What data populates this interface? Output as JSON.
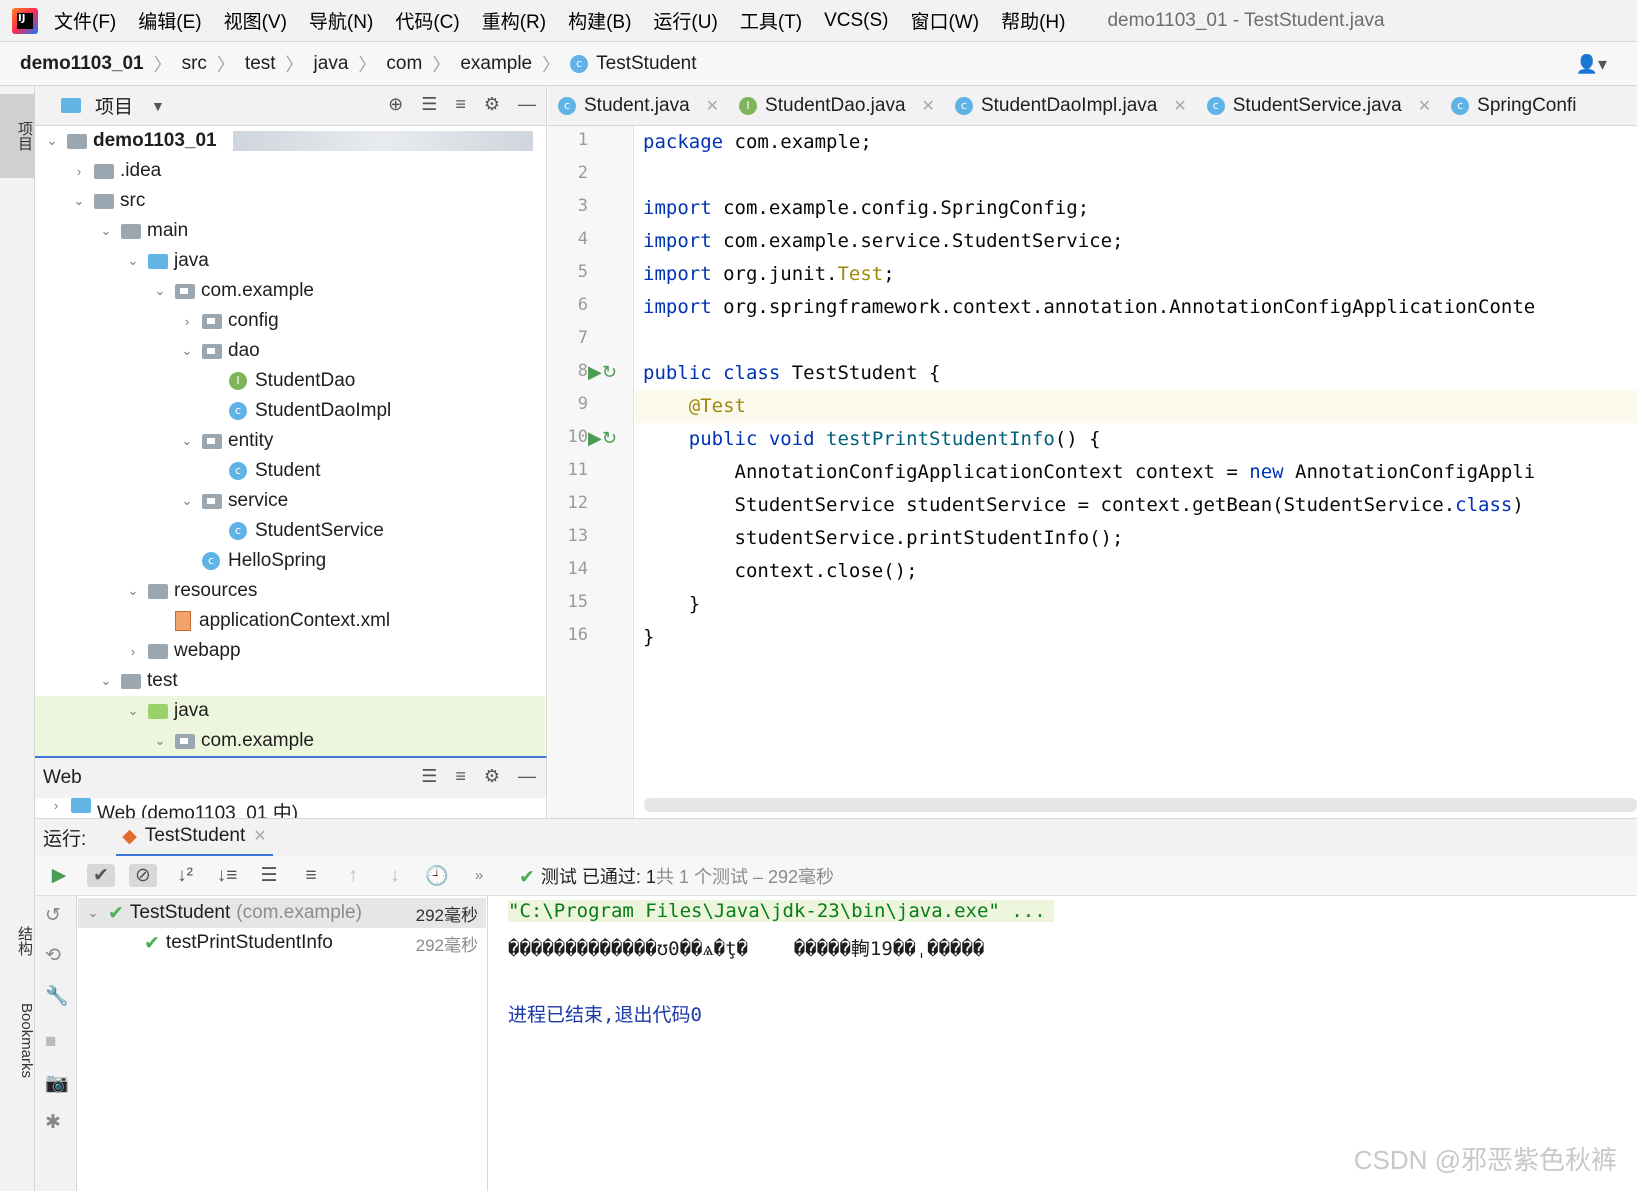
{
  "menu": {
    "items": [
      "文件(F)",
      "编辑(E)",
      "视图(V)",
      "导航(N)",
      "代码(C)",
      "重构(R)",
      "构建(B)",
      "运行(U)",
      "工具(T)",
      "VCS(S)",
      "窗口(W)",
      "帮助(H)"
    ],
    "window_title": "demo1103_01 - TestStudent.java"
  },
  "breadcrumb": [
    "demo1103_01",
    "src",
    "test",
    "java",
    "com",
    "example",
    "TestStudent"
  ],
  "side_tabs": {
    "project": "项目",
    "structure": "结构",
    "bookmarks": "Bookmarks"
  },
  "project": {
    "title": "项目",
    "tree": [
      {
        "label": "demo1103_01",
        "depth": 0,
        "expanded": true
      },
      {
        "label": ".idea",
        "depth": 1,
        "expanded": false
      },
      {
        "label": "src",
        "depth": 1,
        "expanded": true
      },
      {
        "label": "main",
        "depth": 2,
        "expanded": true
      },
      {
        "label": "java",
        "depth": 3,
        "expanded": true
      },
      {
        "label": "com.example",
        "depth": 4,
        "expanded": true
      },
      {
        "label": "config",
        "depth": 5,
        "expanded": false
      },
      {
        "label": "dao",
        "depth": 5,
        "expanded": true
      },
      {
        "label": "StudentDao",
        "depth": 6
      },
      {
        "label": "StudentDaoImpl",
        "depth": 6
      },
      {
        "label": "entity",
        "depth": 5,
        "expanded": true
      },
      {
        "label": "Student",
        "depth": 6
      },
      {
        "label": "service",
        "depth": 5,
        "expanded": true
      },
      {
        "label": "StudentService",
        "depth": 6
      },
      {
        "label": "HelloSpring",
        "depth": 5
      },
      {
        "label": "resources",
        "depth": 3,
        "expanded": true
      },
      {
        "label": "applicationContext.xml",
        "depth": 4
      },
      {
        "label": "webapp",
        "depth": 3,
        "expanded": false
      },
      {
        "label": "test",
        "depth": 2,
        "expanded": true
      },
      {
        "label": "java",
        "depth": 3,
        "expanded": true
      },
      {
        "label": "com.example",
        "depth": 4,
        "expanded": true
      }
    ]
  },
  "web_panel": {
    "title": "Web",
    "item": "Web (demo1103_01 中)"
  },
  "editor": {
    "tabs": [
      "Student.java",
      "StudentDao.java",
      "StudentDaoImpl.java",
      "StudentService.java",
      "SpringConfi"
    ],
    "line_numbers": [
      "1",
      "2",
      "3",
      "4",
      "5",
      "6",
      "7",
      "8",
      "9",
      "10",
      "11",
      "12",
      "13",
      "14",
      "15",
      "16"
    ],
    "lines": [
      "package com.example;",
      "",
      "import com.example.config.SpringConfig;",
      "import com.example.service.StudentService;",
      "import org.junit.Test;",
      "import org.springframework.context.annotation.AnnotationConfigApplicationConte",
      "",
      "public class TestStudent {",
      "    @Test",
      "    public void testPrintStudentInfo() {",
      "        AnnotationConfigApplicationContext context = new AnnotationConfigAppli",
      "        StudentService studentService = context.getBean(StudentService.class)",
      "        studentService.printStudentInfo();",
      "        context.close();",
      "    }",
      "}"
    ]
  },
  "run": {
    "label": "运行:",
    "tab": "TestStudent",
    "status_prefix": "测试 已通过: 1",
    "status_suffix": "共 1 个测试 – 292毫秒",
    "tests": [
      {
        "name": "TestStudent",
        "pkg": "(com.example)",
        "time": "292毫秒"
      },
      {
        "name": "testPrintStudentInfo",
        "pkg": "",
        "time": "292毫秒"
      }
    ],
    "console": {
      "cmd": "\"C:\\Program Files\\Java\\jdk-23\\bin\\java.exe\" ...",
      "garbled": "�������������ʊ0��ѧ�ţ�    �����䡘19��ˌ�����",
      "exit": "进程已结束,退出代码0"
    }
  },
  "watermark": "CSDN @邪恶紫色秋裤"
}
